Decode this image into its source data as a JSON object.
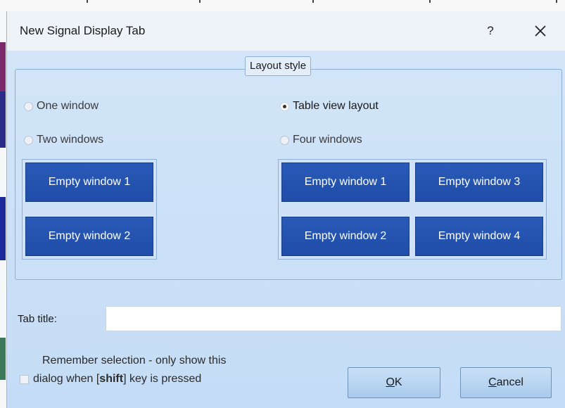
{
  "dialog": {
    "title": "New Signal Display Tab",
    "help_label": "?",
    "close_icon": "close-icon"
  },
  "layout_group": {
    "legend": "Layout style",
    "options": {
      "one_window": {
        "label": "One window",
        "selected": false
      },
      "two_windows": {
        "label": "Two windows",
        "selected": false
      },
      "table_view": {
        "label": "Table view layout",
        "selected": true
      },
      "four_windows": {
        "label": "Four windows",
        "selected": false
      }
    },
    "left_windows": [
      "Empty window 1",
      "Empty window 2"
    ],
    "right_windows": [
      "Empty window 1",
      "Empty window 3",
      "Empty window 2",
      "Empty window 4"
    ]
  },
  "tab_title": {
    "label": "Tab title:",
    "value": "",
    "placeholder": ""
  },
  "remember": {
    "line1": "Remember selection - only show this",
    "line2_prefix": "dialog when [",
    "line2_key": "shift",
    "line2_suffix": "] key is pressed",
    "checked": false
  },
  "buttons": {
    "ok_mnemonic": "O",
    "ok_rest": "K",
    "cancel_mnemonic": "C",
    "cancel_rest": "ancel"
  },
  "colors": {
    "window_button": "#2355b0",
    "dialog_bg": "#cfe3f8",
    "title_bar": "#eef3f8"
  }
}
